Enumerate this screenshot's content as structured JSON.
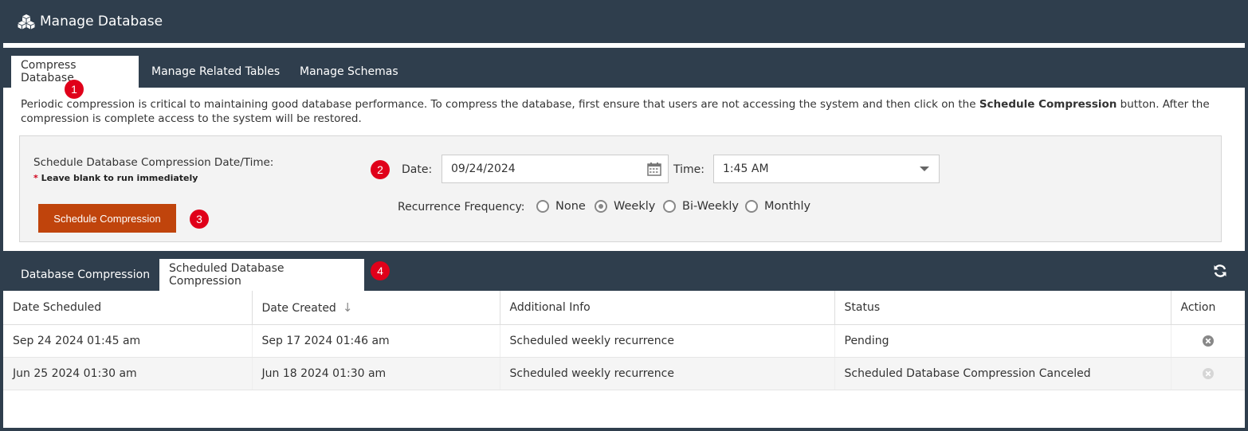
{
  "window": {
    "title": "Manage Database",
    "icon": "database-icon"
  },
  "top_tabs": [
    {
      "label": "Compress Database",
      "active": true
    },
    {
      "label": "Manage Related Tables",
      "active": false
    },
    {
      "label": "Manage Schemas",
      "active": false
    }
  ],
  "badges": {
    "b1": "1",
    "b2": "2",
    "b3": "3",
    "b4": "4"
  },
  "description": {
    "part1": "Periodic compression is critical to maintaining good database performance. To compress the database, first ensure that users are not accessing the system and then click on the ",
    "bold": "Schedule Compression",
    "part2": " button. After the compression is complete access to the system will be restored."
  },
  "schedule": {
    "label": "Schedule Database Compression Date/Time:",
    "hint_star": "*",
    "hint": " Leave blank to run immediately",
    "button": "Schedule Compression",
    "date_label": "Date:",
    "date_value": "09/24/2024",
    "time_label": "Time:",
    "time_value": "1:45 AM",
    "recurrence_label": "Recurrence Frequency:",
    "recurrence_options": [
      {
        "label": "None",
        "checked": false
      },
      {
        "label": "Weekly",
        "checked": true
      },
      {
        "label": "Bi-Weekly",
        "checked": false
      },
      {
        "label": "Monthly",
        "checked": false
      }
    ]
  },
  "bottom_tabs": [
    {
      "label": "Database Compression",
      "active": false
    },
    {
      "label": "Scheduled Database Compression",
      "active": true
    }
  ],
  "table": {
    "columns": [
      "Date Scheduled",
      "Date Created",
      "Additional Info",
      "Status",
      "Action"
    ],
    "sort_indicator": "↓",
    "rows": [
      [
        "Sep 24 2024 01:45 am",
        "Sep 17 2024 01:46 am",
        "Scheduled weekly recurrence",
        "Pending"
      ],
      [
        "Jun 25 2024 01:30 am",
        "Jun 18 2024 01:30 am",
        "Scheduled weekly recurrence",
        "Scheduled Database Compression Canceled"
      ]
    ]
  },
  "colors": {
    "header_bg": "#2f3e4d",
    "button_bg": "#c0440c",
    "badge_red": "#e0001a"
  }
}
